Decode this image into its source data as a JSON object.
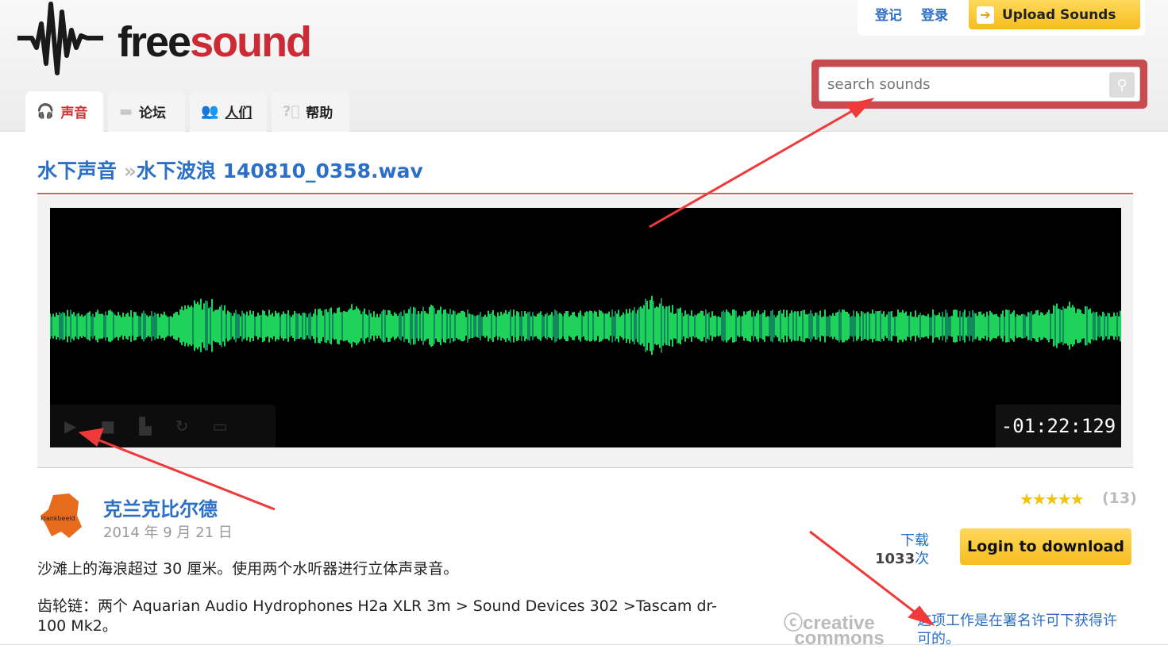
{
  "logo": {
    "part1": "free",
    "part2": "sound"
  },
  "nav": {
    "tabs": [
      {
        "label": "声音",
        "icon": "headphones-icon"
      },
      {
        "label": "论坛",
        "icon": "chat-bubble-icon"
      },
      {
        "label": "人们",
        "icon": "people-icon"
      },
      {
        "label": "帮助",
        "icon": "help-icon"
      }
    ]
  },
  "top": {
    "register": "登记",
    "login": "登录",
    "upload": "Upload Sounds"
  },
  "search": {
    "placeholder": "search sounds"
  },
  "breadcrumb": {
    "parent": "水下声音",
    "sep": "»",
    "current": "水下波浪 140810_0358.wav"
  },
  "player": {
    "time": "-01:22:129",
    "waveform_color": "#1fd35a"
  },
  "sound": {
    "user": "克兰克比尔德",
    "avatar_text": "klankbeeld",
    "date": "2014 年 9 月 21 日",
    "description1": "沙滩上的海浪超过 30 厘米。使用两个水听器进行立体声录音。",
    "description2": "齿轮链：两个 Aquarian Audio Hydrophones H2a XLR 3m > Sound Devices 302 >Tascam dr-100 Mk2。",
    "rating": 5,
    "rating_stars": "★★★★★",
    "rating_count": "(13)",
    "download_label": "下载",
    "download_count": "1033",
    "download_suffix": "次",
    "login_download": "Login to download",
    "cc_logo": "creative commons",
    "license": "这项工作是在署名许可下获得许可的。"
  },
  "colors": {
    "link": "#2b6fc7",
    "brand_red": "#cc2b36",
    "button": "#f6bd1f",
    "annotation_arrow": "#f03a3a"
  }
}
